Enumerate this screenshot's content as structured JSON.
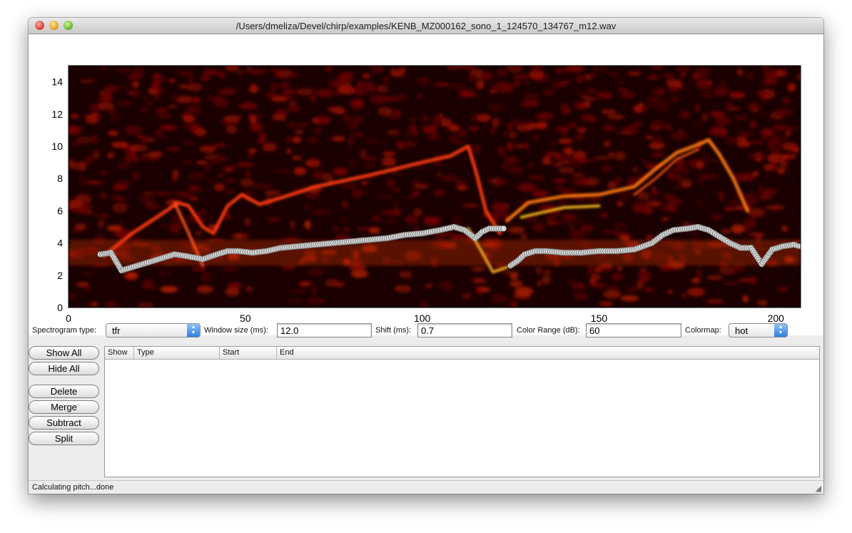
{
  "window": {
    "title": "/Users/dmeliza/Devel/chirp/examples/KENB_MZ000162_sono_1_124570_134767_m12.wav"
  },
  "chart_data": {
    "type": "heatmap",
    "title": "",
    "xlabel": "",
    "ylabel": "",
    "xlim": [
      0,
      207
    ],
    "ylim": [
      0,
      15
    ],
    "x_ticks": [
      "0",
      "50",
      "100",
      "150",
      "200"
    ],
    "y_ticks": [
      "0",
      "2",
      "4",
      "6",
      "8",
      "10",
      "12",
      "14"
    ],
    "colormap": "hot",
    "pitch_series": {
      "name": "",
      "x": [
        9,
        12,
        15,
        18,
        21,
        24,
        27,
        30,
        33,
        38,
        42,
        45,
        48,
        52,
        56,
        60,
        65,
        70,
        75,
        80,
        85,
        90,
        95,
        100,
        105,
        109,
        112,
        115,
        117,
        119,
        121,
        123,
        125,
        127,
        129,
        132,
        135,
        140,
        145,
        150,
        155,
        160,
        165,
        168,
        171,
        175,
        178,
        181,
        184,
        187,
        190,
        193,
        196,
        199,
        202,
        205,
        207
      ],
      "y": [
        3.3,
        3.4,
        2.3,
        2.5,
        2.7,
        2.9,
        3.1,
        3.3,
        3.2,
        3.0,
        3.3,
        3.5,
        3.5,
        3.4,
        3.5,
        3.7,
        3.8,
        3.9,
        4.0,
        4.1,
        4.2,
        4.3,
        4.5,
        4.6,
        4.8,
        5.0,
        4.8,
        4.3,
        4.7,
        4.9,
        4.9,
        4.9,
        2.6,
        2.9,
        3.3,
        3.5,
        3.5,
        3.4,
        3.4,
        3.5,
        3.5,
        3.6,
        4.0,
        4.5,
        4.8,
        4.9,
        5.0,
        4.8,
        4.4,
        4.0,
        3.7,
        3.7,
        2.7,
        3.6,
        3.8,
        3.9,
        3.8
      ]
    }
  },
  "controls": {
    "spectrogram_type_label": "Spectrogram type:",
    "spectrogram_type_value": "tfr",
    "window_size_label": "Window size (ms):",
    "window_size_value": "12.0",
    "shift_label": "Shift (ms):",
    "shift_value": "0.7",
    "color_range_label": "Color Range (dB):",
    "color_range_value": "60",
    "colormap_label": "Colormap:",
    "colormap_value": "hot"
  },
  "buttons": {
    "show_all": "Show All",
    "hide_all": "Hide All",
    "delete": "Delete",
    "merge": "Merge",
    "subtract": "Subtract",
    "split": "Split"
  },
  "table": {
    "columns": [
      "Show",
      "Type",
      "Start",
      "End"
    ]
  },
  "status": {
    "text": "Calculating pitch...done"
  }
}
